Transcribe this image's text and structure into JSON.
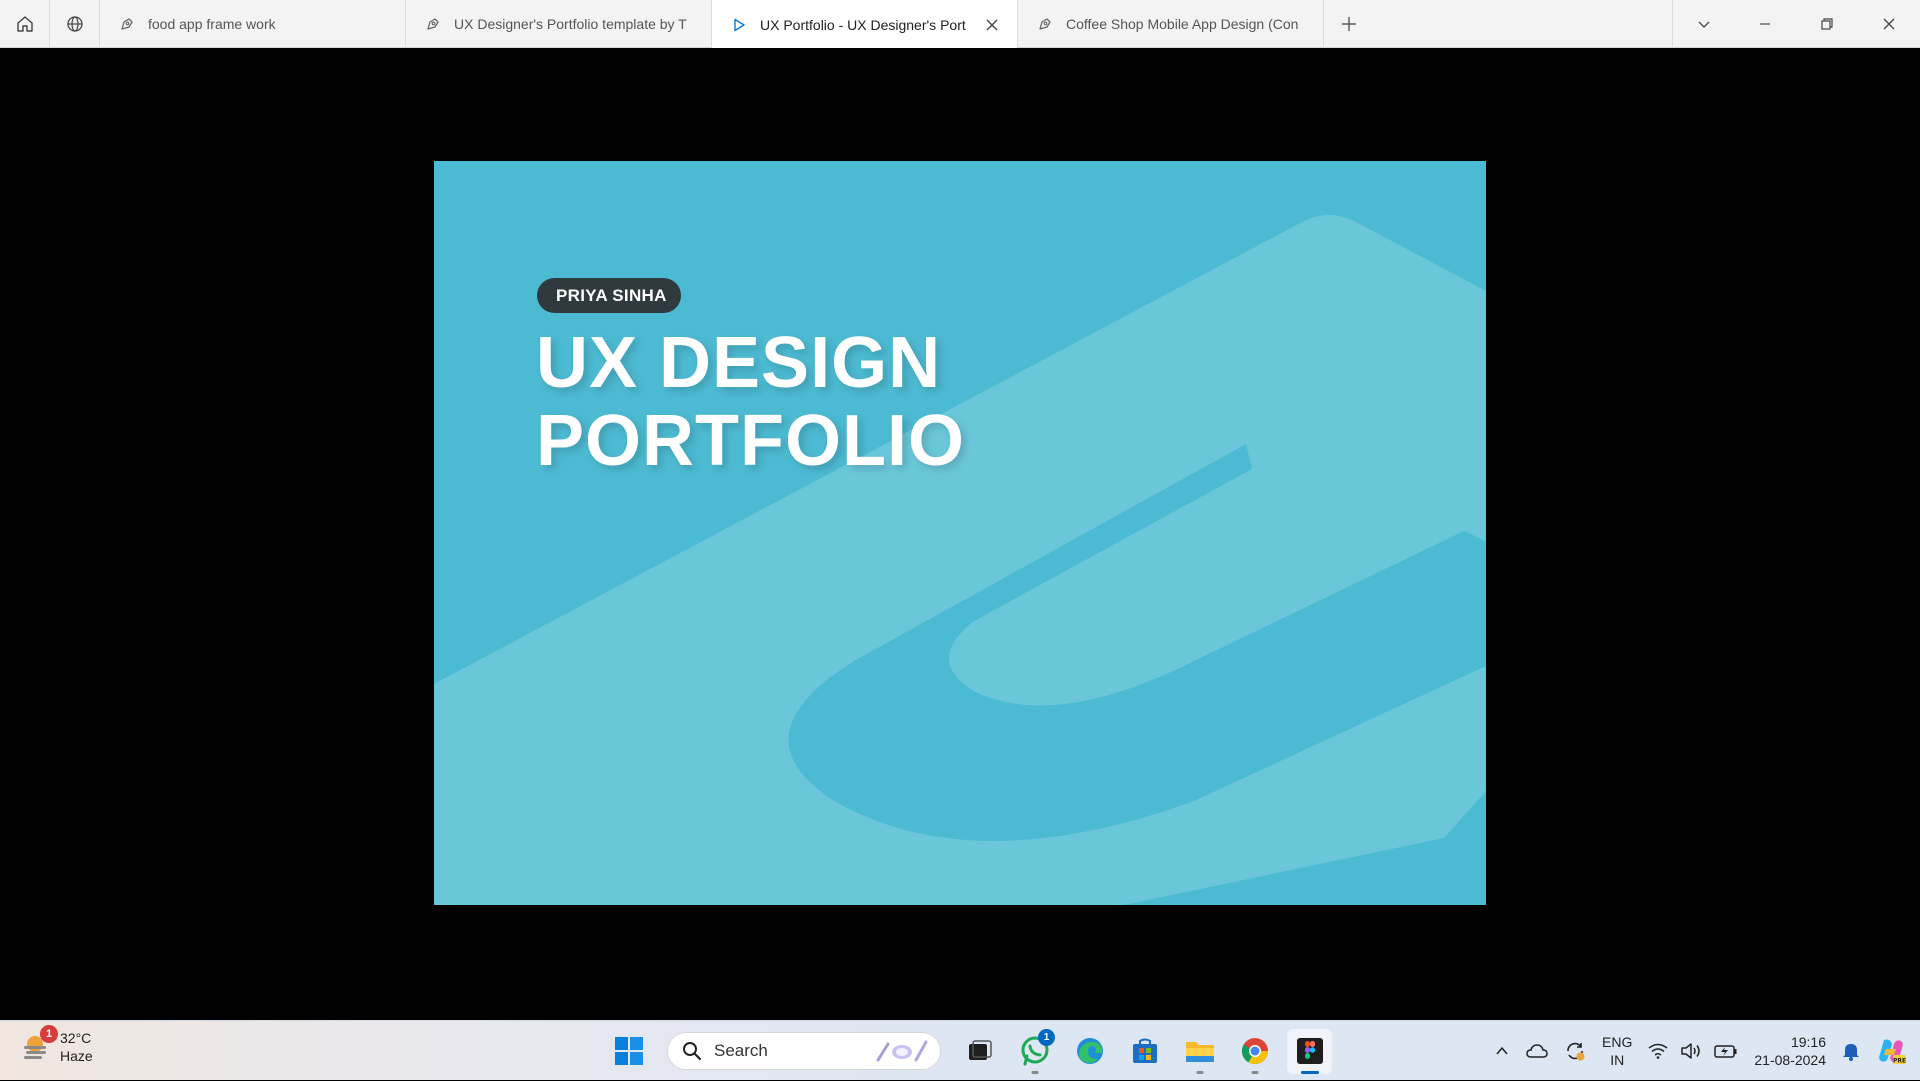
{
  "browser": {
    "tabs": [
      {
        "label": "food app frame work",
        "icon": "figma-design-icon",
        "active": false
      },
      {
        "label": "UX Designer's Portfolio template by T",
        "icon": "figma-design-icon",
        "active": false
      },
      {
        "label": "UX Portfolio - UX Designer's Port",
        "icon": "play-prototype-icon",
        "active": true
      },
      {
        "label": "Coffee Shop Mobile App Design (Con",
        "icon": "figma-design-icon",
        "active": false
      }
    ]
  },
  "slide": {
    "name_tag": "PRIYA SINHA",
    "title_line1": "UX DESIGN",
    "title_line2": "PORTFOLIO",
    "colors": {
      "background": "#4cbad2",
      "shape": "#6ac7da",
      "pill": "#2f3a3e"
    }
  },
  "taskbar": {
    "weather": {
      "temperature": "32°C",
      "condition": "Haze",
      "badge": "1"
    },
    "search_placeholder": "Search",
    "whatsapp_badge": "1",
    "language_top": "ENG",
    "language_bottom": "IN",
    "time": "19:16",
    "date": "21-08-2024"
  }
}
